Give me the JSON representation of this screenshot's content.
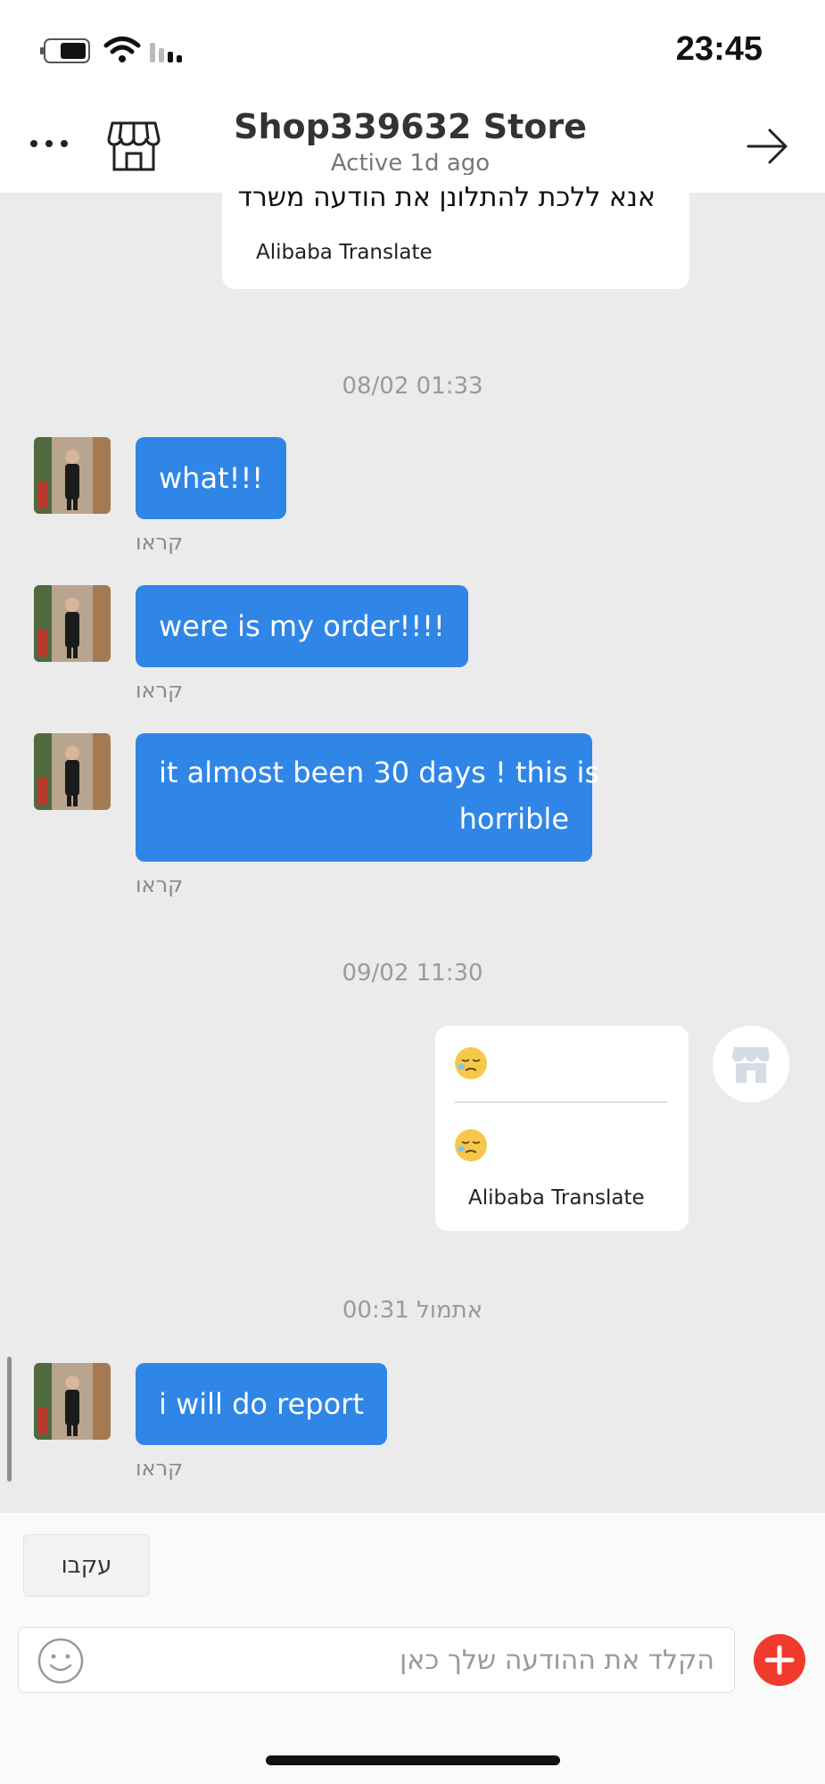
{
  "status_bar": {
    "time": "23:45"
  },
  "header": {
    "title": "Shop339632 Store",
    "subtitle": "Active 1d ago",
    "icons": {
      "more": "more-dots-icon",
      "store": "store-icon",
      "back": "arrow-right-icon"
    }
  },
  "messages": {
    "top_card": {
      "text": "אנא ללכת להתלונן את הודעה משרד",
      "translate_label": "Alibaba Translate"
    },
    "timestamp_1": "08/02 01:33",
    "bubble_1": {
      "text": "what!!!",
      "status": "קראו"
    },
    "bubble_2": {
      "text": "were is my order!!!!",
      "status": "קראו"
    },
    "bubble_3": {
      "line1": "it almost been 30 days ! this is",
      "line2": "horrible",
      "status": "קראו"
    },
    "timestamp_2": "09/02 11:30",
    "reply_card": {
      "emoji": "😪",
      "translated_emoji": "😪",
      "translate_label": "Alibaba Translate"
    },
    "timestamp_3": "אתמול 00:31",
    "bubble_4": {
      "text": "i will do report",
      "status": "קראו"
    }
  },
  "bottom": {
    "follow_label": "עקבו",
    "input_placeholder": "הקלד את ההודעה שלך כאן",
    "icons": {
      "emoji": "smiley-icon",
      "plus": "plus-icon"
    }
  },
  "colors": {
    "bubble": "#2f86e6",
    "plus_button": "#f03a2b",
    "chat_bg": "#ebebeb"
  }
}
